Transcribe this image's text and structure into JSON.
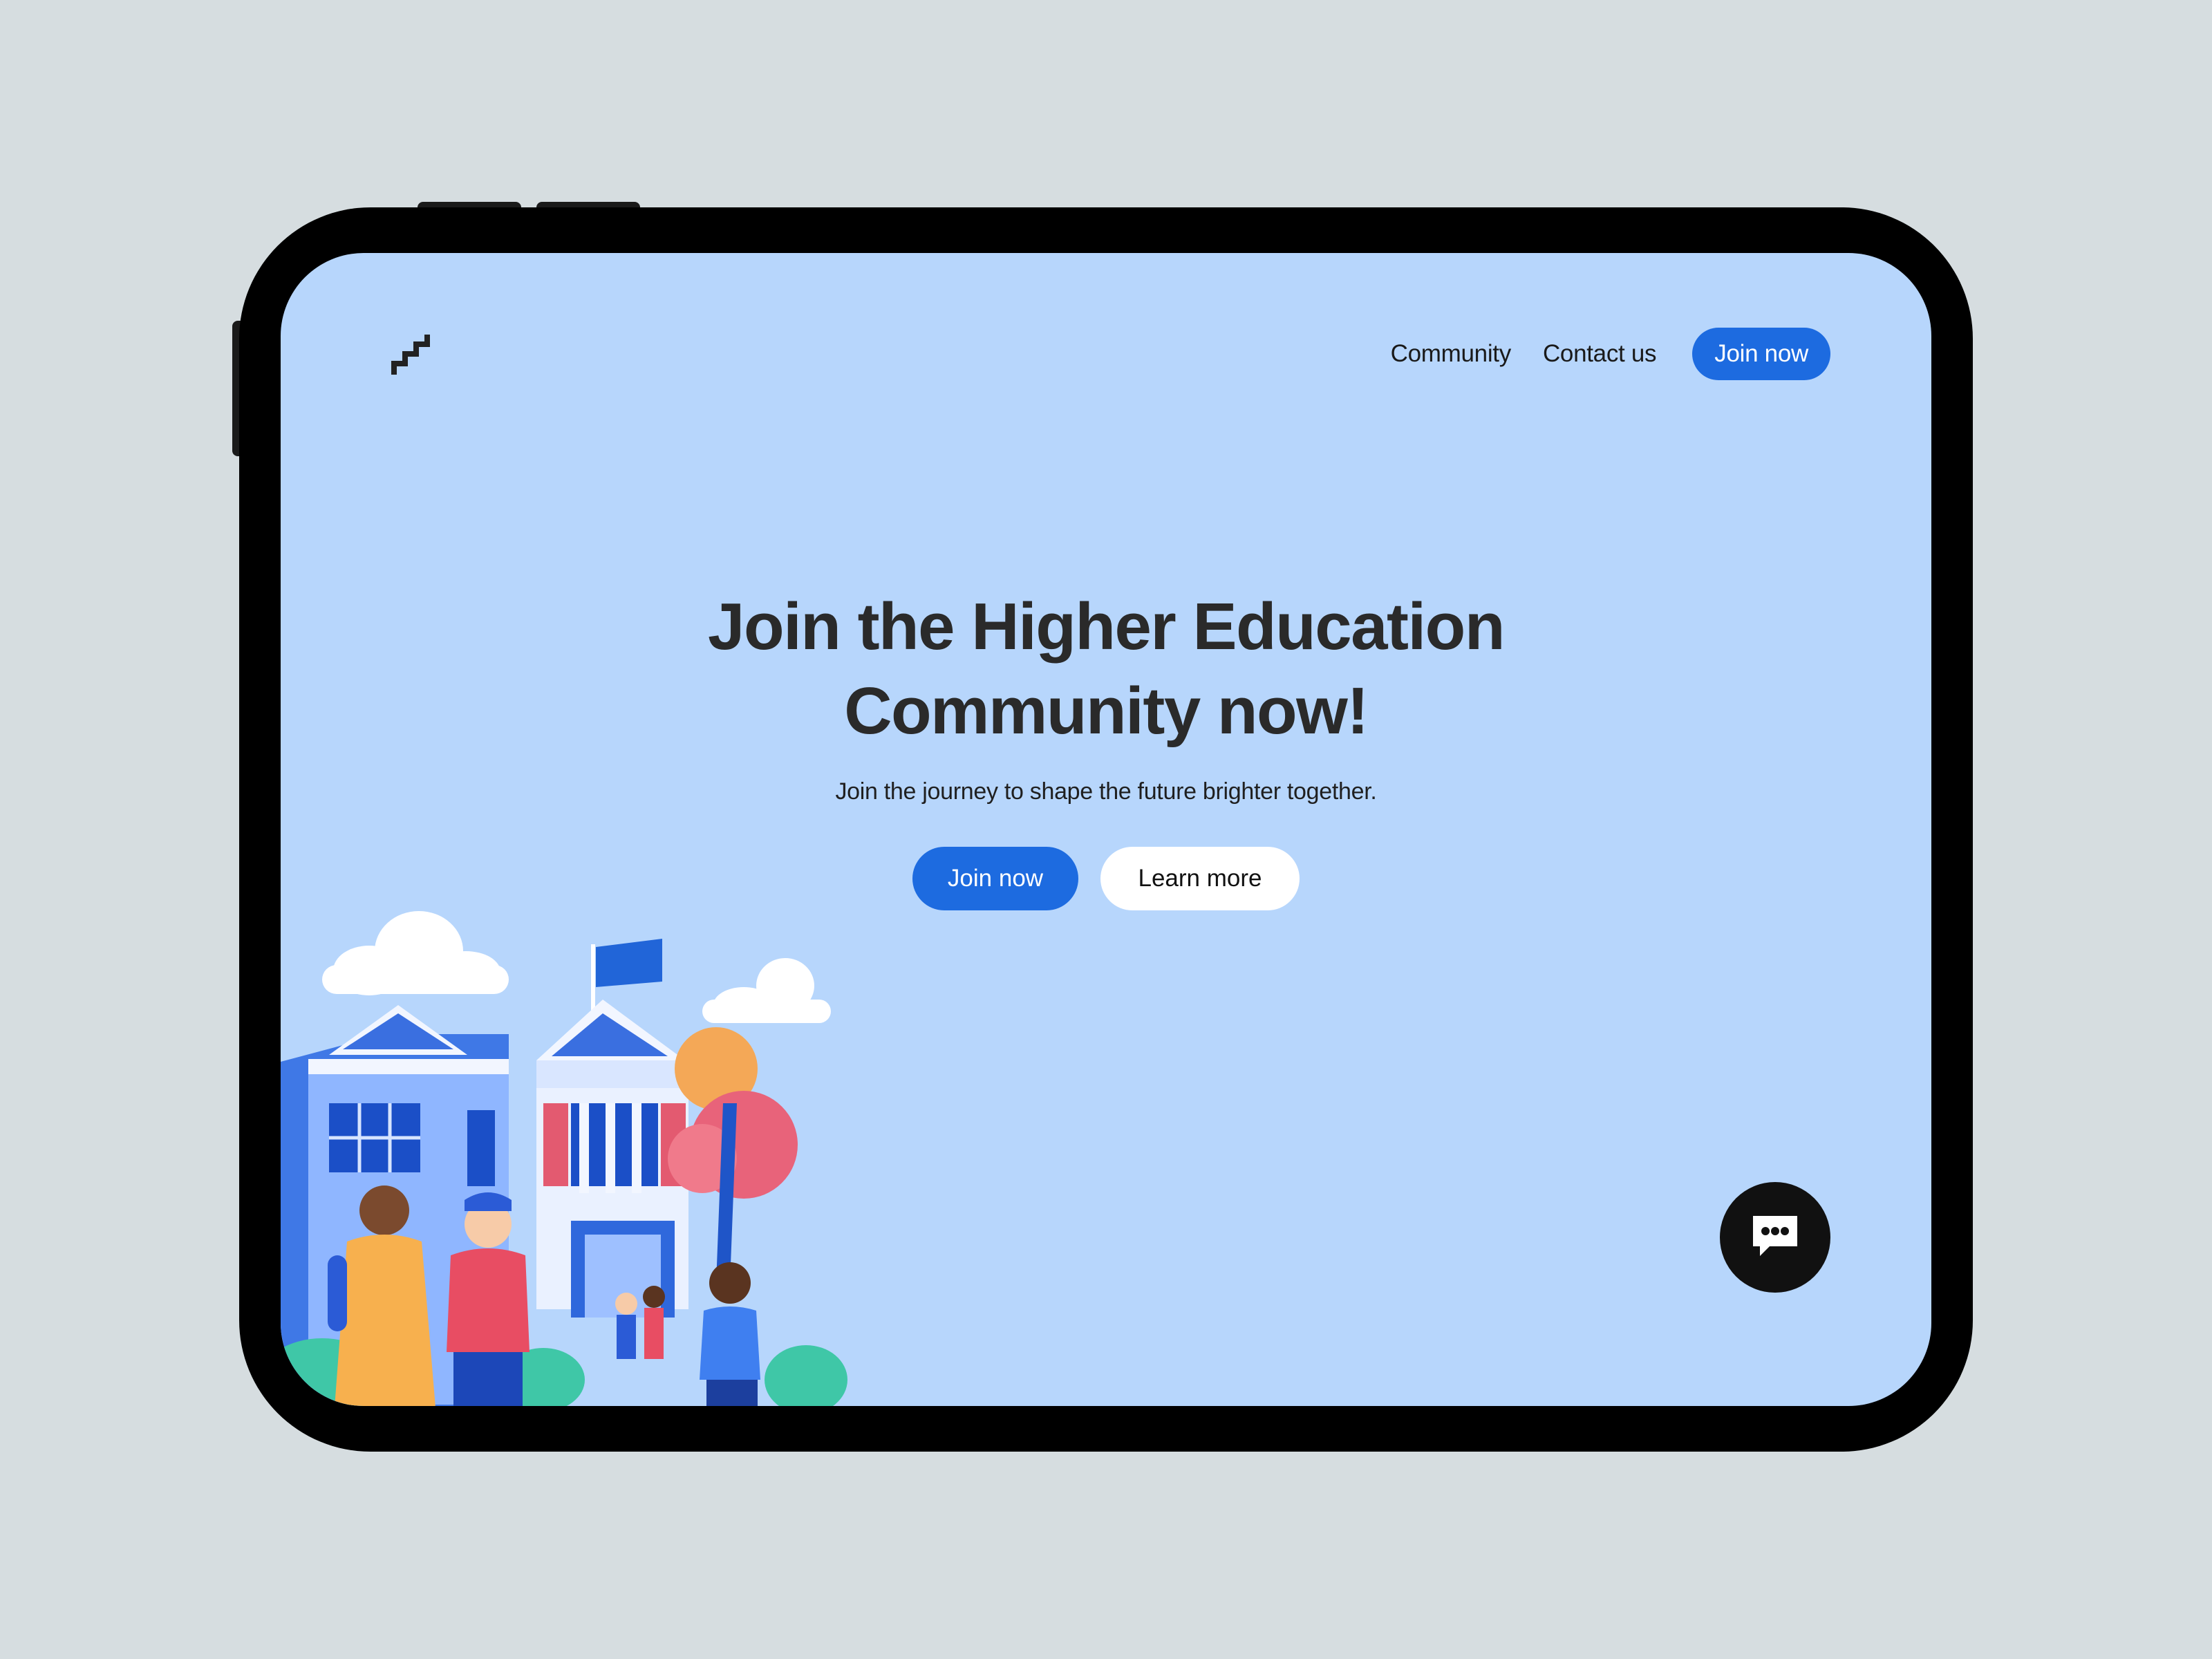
{
  "colors": {
    "background": "#d6dde0",
    "screen": "#b7d6fc",
    "accent": "#1d6be0",
    "text": "#2a2a2a"
  },
  "header": {
    "logo_icon": "stairs-logo-icon",
    "nav": {
      "community": "Community",
      "contact": "Contact us",
      "join": "Join now"
    }
  },
  "hero": {
    "title_line1": "Join the Higher Education",
    "title_line2": "Community now!",
    "subtitle": "Join the journey to shape the future brighter together.",
    "primary_cta": "Join now",
    "secondary_cta": "Learn more"
  },
  "illustration": {
    "icon": "campus-students-illustration"
  },
  "chat": {
    "icon": "chat-bubble-icon"
  }
}
